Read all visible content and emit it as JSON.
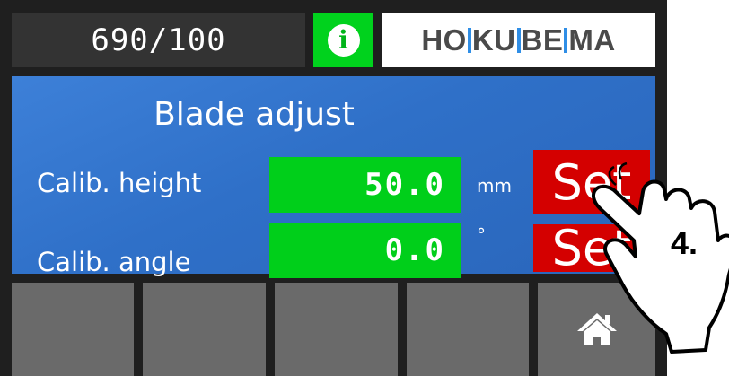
{
  "header": {
    "counter": "690/100",
    "info_icon": "info-icon",
    "logo_text": "HOKUBEMA"
  },
  "panel": {
    "title": "Blade adjust",
    "rows": [
      {
        "label": "Calib. height",
        "value": "50.0",
        "unit": "mm",
        "button": "Set"
      },
      {
        "label": "Calib. angle",
        "value": "0.0",
        "unit": "°",
        "button": "Set"
      }
    ]
  },
  "footer": {
    "buttons": [
      "",
      "",
      "",
      "",
      "home-icon"
    ]
  },
  "annotation": {
    "step_label": "4.",
    "icon": "pointing-hand-icon"
  },
  "colors": {
    "accent_green": "#00cf1a",
    "panel_blue": "#3d80d8",
    "button_red": "#d40000",
    "footer_gray": "#6a6a6a"
  }
}
